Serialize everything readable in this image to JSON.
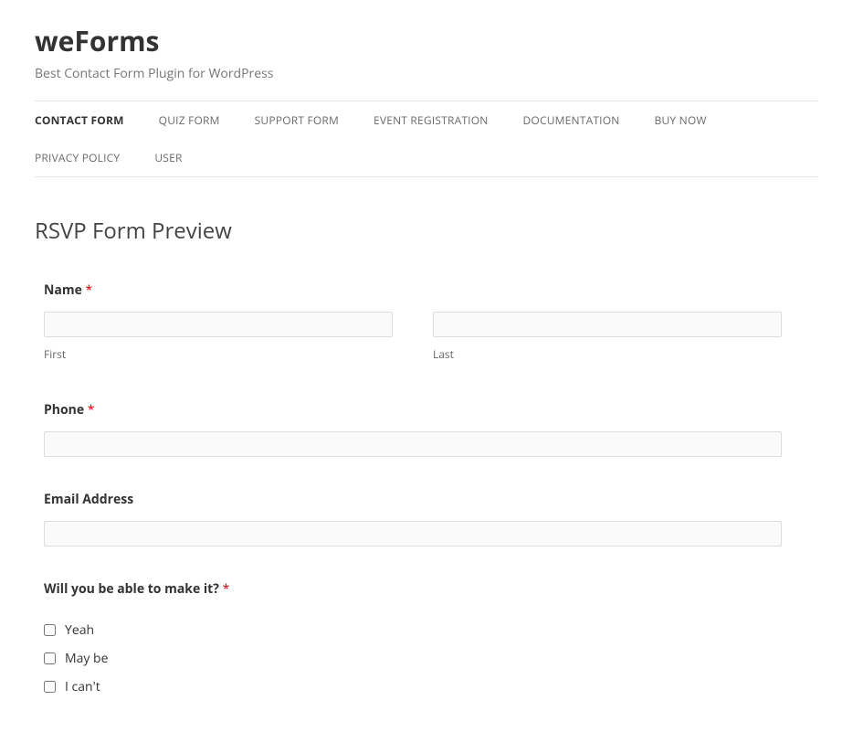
{
  "site": {
    "title": "weForms",
    "tagline": "Best Contact Form Plugin for WordPress"
  },
  "nav": {
    "items": [
      "CONTACT FORM",
      "QUIZ FORM",
      "SUPPORT FORM",
      "EVENT REGISTRATION",
      "DOCUMENTATION",
      "BUY NOW",
      "PRIVACY POLICY",
      "USER"
    ]
  },
  "page": {
    "title": "RSVP Form Preview"
  },
  "form": {
    "name": {
      "label": "Name",
      "required_mark": "*",
      "first_sub": "First",
      "last_sub": "Last",
      "first_value": "",
      "last_value": ""
    },
    "phone": {
      "label": "Phone",
      "required_mark": "*",
      "value": ""
    },
    "email": {
      "label": "Email Address",
      "value": ""
    },
    "attend": {
      "label": "Will you be able to make it?",
      "required_mark": "*",
      "options": [
        "Yeah",
        "May be",
        "I can't"
      ]
    }
  }
}
